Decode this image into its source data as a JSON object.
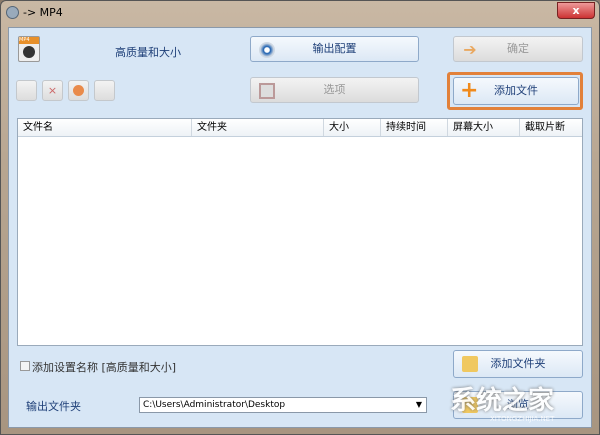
{
  "window": {
    "title": "-> MP4",
    "close": "x"
  },
  "preset_name": "高质量和大小",
  "buttons": {
    "output_config": "输出配置",
    "ok": "确定",
    "options": "选项",
    "add_file": "添加文件",
    "add_folder": "添加文件夹",
    "browse": "浏览"
  },
  "table": {
    "columns": [
      "文件名",
      "文件夹",
      "大小",
      "持续时间",
      "屏幕大小",
      "截取片断"
    ]
  },
  "checkbox": {
    "label": "添加设置名称 [高质量和大小]",
    "checked": false
  },
  "output": {
    "label": "输出文件夹",
    "path": "C:\\Users\\Administrator\\Desktop"
  },
  "watermark": {
    "text": "系统之家",
    "url": "XITONGZHIJIA.NET"
  }
}
